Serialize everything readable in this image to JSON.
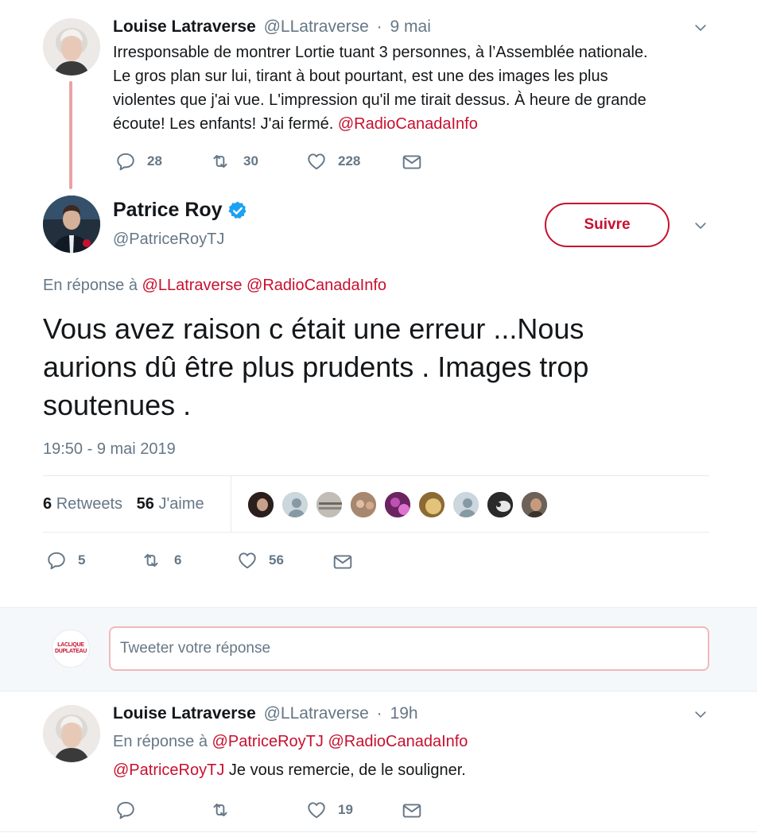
{
  "colors": {
    "accent": "#c8102e",
    "muted": "#657786",
    "verified": "#1da1f2"
  },
  "tweet1": {
    "name": "Louise Latraverse",
    "handle": "@LLatraverse",
    "sep": "·",
    "time": "9 mai",
    "text_line1": "Irresponsable de montrer Lortie tuant 3 personnes, à l’Assemblée nationale.",
    "text_line2": "Le gros plan sur lui, tirant à bout pourtant, est une des images les plus",
    "text_line3": "violentes que j'ai vue. L'impression qu'il me tirait dessus. À heure de grande",
    "text_line4": "écoute! Les enfants! J'ai fermé.",
    "mention": "@RadioCanadaInfo",
    "replies": "28",
    "retweets": "30",
    "likes": "228"
  },
  "main": {
    "name": "Patrice Roy",
    "handle": "@PatriceRoyTJ",
    "follow_label": "Suivre",
    "reply_prefix": "En réponse à",
    "reply_to_1": "@LLatraverse",
    "reply_to_2": "@RadioCanadaInfo",
    "text_line1": "Vous avez raison c était une erreur ...Nous",
    "text_line2": "aurions dû être plus prudents . Images trop",
    "text_line3": "soutenues .",
    "timestamp": "19:50 - 9 mai 2019",
    "retweet_count": "6",
    "retweet_label": "Retweets",
    "like_count": "56",
    "like_label": "J'aime",
    "replies": "5",
    "retweets": "6",
    "likes": "56"
  },
  "compose": {
    "logo_line1": "LACLIQUE",
    "logo_line2": "DUPLATEAU",
    "placeholder": "Tweeter votre réponse"
  },
  "tweet3": {
    "name": "Louise Latraverse",
    "handle": "@LLatraverse",
    "sep": "·",
    "time": "19h",
    "reply_prefix": "En réponse à",
    "reply_to_1": "@PatriceRoyTJ",
    "reply_to_2": "@RadioCanadaInfo",
    "mention": "@PatriceRoyTJ",
    "text": "Je vous remercie, de le souligner.",
    "replies": "",
    "retweets": "",
    "likes": "19"
  }
}
